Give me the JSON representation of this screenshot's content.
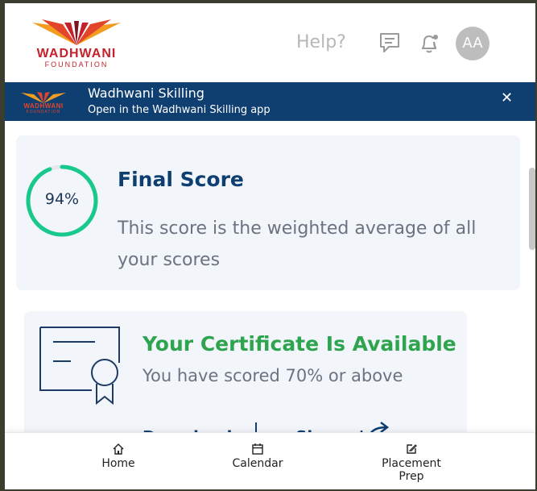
{
  "header": {
    "logo_name": "WADHWANI",
    "logo_sub": "FOUNDATION",
    "help_label": "Help?",
    "chat_icon": "chat-icon",
    "bell_icon": "bell-icon",
    "avatar_initials": "AA"
  },
  "banner": {
    "logo_name": "WADHWANI",
    "logo_sub": "FOUNDATION",
    "title": "Wadhwani Skilling",
    "subtitle": "Open in the Wadhwani Skilling app",
    "close_symbol": "✕"
  },
  "score": {
    "percent_label": "94%",
    "percent_value": 94,
    "title": "Final Score",
    "description": "This score is the weighted average of all your scores"
  },
  "certificate": {
    "title": "Your Certificate Is Available",
    "subtitle": "You have scored 70% or above",
    "download_label": "Download",
    "share_label": "Share"
  },
  "bottom_nav": {
    "home": "Home",
    "calendar": "Calendar",
    "placement_line1": "Placement",
    "placement_line2": "Prep"
  },
  "colors": {
    "brand_navy": "#0f3f70",
    "brand_red": "#c4222b",
    "brand_orange": "#f39c1f",
    "ring_green": "#19c88c",
    "cert_green": "#2fa44f"
  }
}
